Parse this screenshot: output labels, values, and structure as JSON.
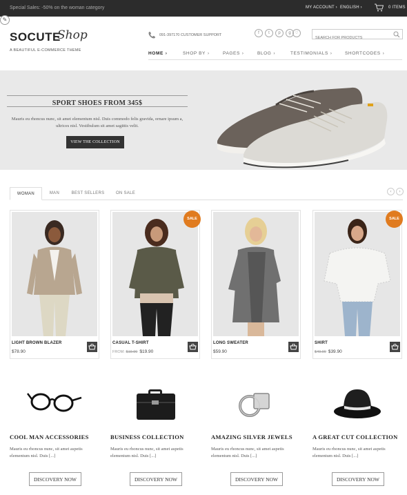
{
  "topbar": {
    "promo": "Special Sales: -50% on the woman category",
    "my_account": "MY ACCOUNT ›",
    "language": "ENGLISH ›",
    "cart_items": "0 ITEMS"
  },
  "header": {
    "logo_main": "SOCUTE",
    "logo_script": "Shop",
    "tagline": "A BEAUTIFUL E-COMMERCE THEME",
    "support": "091-397170 CUSTOMER SUPPORT",
    "search_placeholder": "SEARCH FOR PRODUCTS",
    "social": [
      "f",
      "t",
      "p",
      "g",
      "♡"
    ]
  },
  "nav": {
    "items": [
      {
        "label": "HOME"
      },
      {
        "label": "SHOP BY"
      },
      {
        "label": "PAGES"
      },
      {
        "label": "BLOG"
      },
      {
        "label": "TESTIMONIALS"
      },
      {
        "label": "SHORTCODES"
      }
    ]
  },
  "hero": {
    "title": "SPORT SHOES FROM 345$",
    "text": "Mauris eu rhoncus nunc, sit amet elementum nisl. Duis commodo felis gravida, ornare ipsum a, ultrices nisl. Vestibulum sit amet sagittis velit.",
    "cta": "VIEW THE COLLECTION"
  },
  "tabs": [
    "WOMAN",
    "MAN",
    "BEST SELLERS",
    "ON SALE"
  ],
  "products": [
    {
      "name": "LIGHT BROWN BLAZER",
      "price": "$78.90",
      "old_price": "",
      "from": "",
      "sale": ""
    },
    {
      "name": "CASUAL T-SHIRT",
      "price": "$19.90",
      "old_price": "$19.90",
      "from": "FROM:",
      "sale": "SALE"
    },
    {
      "name": "LONG SWEATER",
      "price": "$59.90",
      "old_price": "",
      "from": "",
      "sale": ""
    },
    {
      "name": "SHIRT",
      "price": "$39.90",
      "old_price": "$49.90",
      "from": "",
      "sale": "SALE"
    }
  ],
  "features": [
    {
      "title": "COOL MAN ACCESSORIES",
      "text": "Mauris eu rhoncus nunc, sit amet aspetis elementum nisl. Duis [...]",
      "button": "DISCOVERY NOW"
    },
    {
      "title": "BUSINESS COLLECTION",
      "text": "Mauris eu rhoncus nunc, sit amet aspetis elementum nisl. Duis [...]",
      "button": "DISCOVERY NOW"
    },
    {
      "title": "AMAZING SILVER JEWELS",
      "text": "Mauris eu rhoncus nunc, sit amet aspetis elementum nisl. Duis [...]",
      "button": "DISCOVERY NOW"
    },
    {
      "title": "A GREAT CUT COLLECTION",
      "text": "Mauris eu rhoncus nunc, sit amet aspetis elementum nisl. Duis [...]",
      "button": "DISCOVERY NOW"
    }
  ],
  "colors": {
    "topbar": "#2c2c2c",
    "sale_badge": "#e07b1f",
    "button_dark": "#333333",
    "hero_bg": "#e9e9e9"
  },
  "icons": [
    "pencil-icon",
    "cart-icon",
    "phone-icon",
    "search-icon",
    "basket-icon",
    "chevron-left-icon",
    "chevron-right-icon"
  ]
}
